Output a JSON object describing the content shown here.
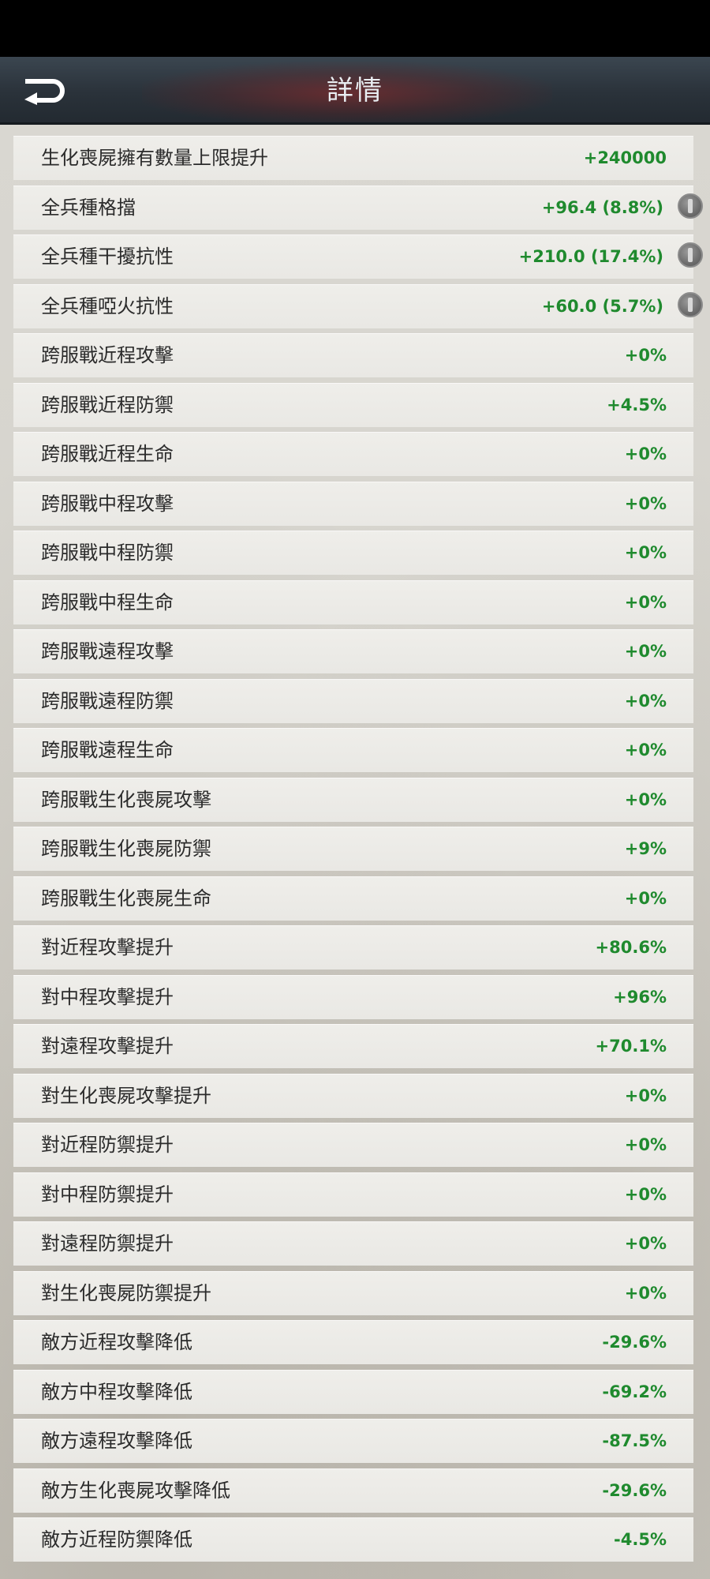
{
  "header": {
    "title": "詳情"
  },
  "colors": {
    "positive": "#1f8a2e",
    "negative": "#1f8a2e"
  },
  "rows": [
    {
      "label": "生化喪屍擁有數量上限提升",
      "value": "+240000",
      "info": false
    },
    {
      "label": "全兵種格擋",
      "value": "+96.4 (8.8%)",
      "info": true
    },
    {
      "label": "全兵種干擾抗性",
      "value": "+210.0 (17.4%)",
      "info": true
    },
    {
      "label": "全兵種啞火抗性",
      "value": "+60.0 (5.7%)",
      "info": true
    },
    {
      "label": "跨服戰近程攻擊",
      "value": "+0%",
      "info": false
    },
    {
      "label": "跨服戰近程防禦",
      "value": "+4.5%",
      "info": false
    },
    {
      "label": "跨服戰近程生命",
      "value": "+0%",
      "info": false
    },
    {
      "label": "跨服戰中程攻擊",
      "value": "+0%",
      "info": false
    },
    {
      "label": "跨服戰中程防禦",
      "value": "+0%",
      "info": false
    },
    {
      "label": "跨服戰中程生命",
      "value": "+0%",
      "info": false
    },
    {
      "label": "跨服戰遠程攻擊",
      "value": "+0%",
      "info": false
    },
    {
      "label": "跨服戰遠程防禦",
      "value": "+0%",
      "info": false
    },
    {
      "label": "跨服戰遠程生命",
      "value": "+0%",
      "info": false
    },
    {
      "label": "跨服戰生化喪屍攻擊",
      "value": "+0%",
      "info": false
    },
    {
      "label": "跨服戰生化喪屍防禦",
      "value": "+9%",
      "info": false
    },
    {
      "label": "跨服戰生化喪屍生命",
      "value": "+0%",
      "info": false
    },
    {
      "label": "對近程攻擊提升",
      "value": "+80.6%",
      "info": false
    },
    {
      "label": "對中程攻擊提升",
      "value": "+96%",
      "info": false
    },
    {
      "label": "對遠程攻擊提升",
      "value": "+70.1%",
      "info": false
    },
    {
      "label": "對生化喪屍攻擊提升",
      "value": "+0%",
      "info": false
    },
    {
      "label": "對近程防禦提升",
      "value": "+0%",
      "info": false
    },
    {
      "label": "對中程防禦提升",
      "value": "+0%",
      "info": false
    },
    {
      "label": "對遠程防禦提升",
      "value": "+0%",
      "info": false
    },
    {
      "label": "對生化喪屍防禦提升",
      "value": "+0%",
      "info": false
    },
    {
      "label": "敵方近程攻擊降低",
      "value": "-29.6%",
      "info": false
    },
    {
      "label": "敵方中程攻擊降低",
      "value": "-69.2%",
      "info": false
    },
    {
      "label": "敵方遠程攻擊降低",
      "value": "-87.5%",
      "info": false
    },
    {
      "label": "敵方生化喪屍攻擊降低",
      "value": "-29.6%",
      "info": false
    },
    {
      "label": "敵方近程防禦降低",
      "value": "-4.5%",
      "info": false
    }
  ]
}
